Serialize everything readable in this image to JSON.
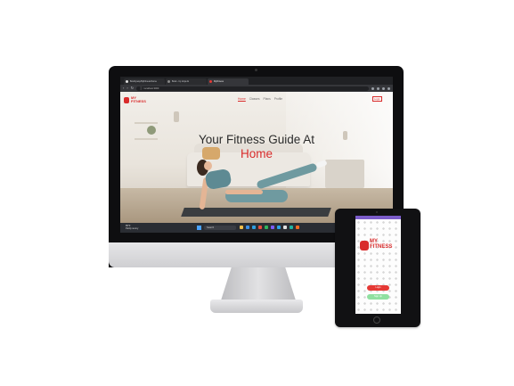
{
  "browser": {
    "tabs": [
      {
        "label": "Bootbyway/MyFitness/home",
        "icon": "github-icon",
        "active": false
      },
      {
        "label": "Book - by ninja do",
        "icon": "page-icon",
        "active": false
      },
      {
        "label": "MyFitness",
        "icon": "fitness-icon",
        "active": true
      }
    ],
    "url": "localhost:3000"
  },
  "site": {
    "brand_line1": "MY",
    "brand_line2": "FITNESS",
    "nav": [
      "Home",
      "Classes",
      "Plans",
      "Profile"
    ],
    "login": "Login",
    "hero_title": "Your Fitness Guide At",
    "hero_subtitle": "Home"
  },
  "taskbar": {
    "weather_line1": "85°F",
    "weather_line2": "Partly sunny",
    "search_placeholder": "Search",
    "time": "10:45 PM",
    "date": "6/19/2023",
    "app_colors": [
      "#f3c04b",
      "#3a8ee6",
      "#2f9ee0",
      "#e74c3c",
      "#30b55c",
      "#7c5cff",
      "#2aa3e6",
      "#e0e0e0",
      "#1fb3a0",
      "#f26a21"
    ]
  },
  "tablet": {
    "brand_line1": "MY",
    "brand_line2": "FITNESS",
    "login_button": "Login",
    "signup_button": "Sign Up"
  }
}
